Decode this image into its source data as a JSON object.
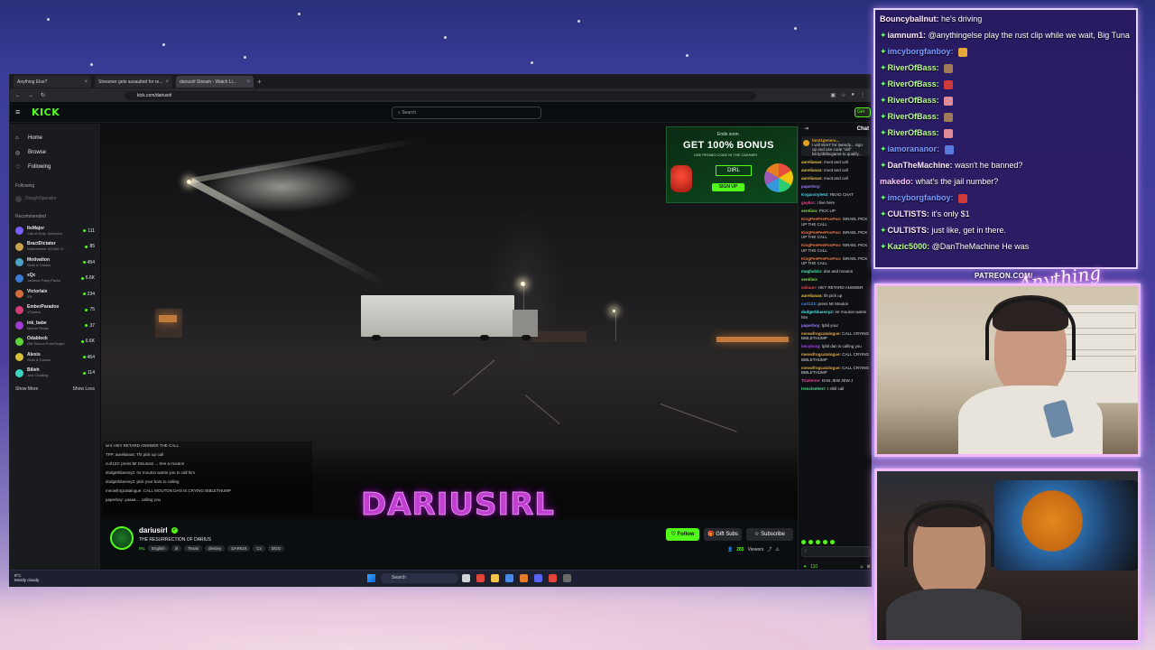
{
  "browser": {
    "tabs": [
      {
        "label": "Anything Else?",
        "active": false
      },
      {
        "label": "Streamer gets assaulted for re...",
        "active": false
      },
      {
        "label": "dariusirl Stream - Watch Li...",
        "active": true
      }
    ],
    "url": "kick.com/dariusirl"
  },
  "kick": {
    "logo": "KICK",
    "search_placeholder": "Search",
    "get_label": "Get",
    "nav": [
      {
        "label": "Home",
        "icon": "home-icon"
      },
      {
        "label": "Browse",
        "icon": "compass-icon"
      },
      {
        "label": "Following",
        "icon": "heart-icon"
      }
    ],
    "following_header": "Following",
    "followed_channel": "DoughOperator",
    "recommended_header": "Recommended",
    "recommended": [
      {
        "name": "ItsMajor",
        "category": "Call of Duty: Warzone",
        "viewers": "111",
        "color": "#7a5cff"
      },
      {
        "name": "BractDictator",
        "category": "Warhammer 40,000: D...",
        "viewers": "85",
        "color": "#c8a24a"
      },
      {
        "name": "Motivation",
        "category": "Slots & Casino",
        "viewers": "454",
        "color": "#4aa3c8"
      },
      {
        "name": "xQc",
        "category": "Jackbox Party Packs",
        "viewers": "6.6K",
        "color": "#3a7bd5"
      },
      {
        "name": "Victorlaix",
        "category": "IRL",
        "viewers": "234",
        "color": "#d56a3a"
      },
      {
        "name": "EmberParadox",
        "category": "VTubers",
        "viewers": "75",
        "color": "#d53a7b"
      },
      {
        "name": "ink_babe",
        "category": "Marvel Rivals",
        "viewers": "37",
        "color": "#a43ad5"
      },
      {
        "name": "Odablock",
        "category": "Old School RuneScape",
        "viewers": "6.6K",
        "color": "#5ad53a"
      },
      {
        "name": "Alexis",
        "category": "Slots & Casino",
        "viewers": "454",
        "color": "#d5c13a"
      },
      {
        "name": "Bilieh",
        "category": "Just Chatting",
        "viewers": "114",
        "color": "#3ad5c1"
      }
    ],
    "show_more": "Show More",
    "show_less": "Show Less"
  },
  "video": {
    "watermark": "DARIUSIRL",
    "overlay_chat": [
      "ivnl: HEY RETARD ANSWER THE CALL",
      "TFP: aurelianas: Tfs pick up call",
      "curl123: press Mr Moutons ... tree a mouton",
      "dodgerbluesny2: mr mouton wants you to call him",
      "dodgerbluesny2: pick your bars to calling",
      "meowfrogcatalogue: CALL MOUTON DAN IS CRYING BIBLETHUMP",
      "paperboy: yaaaa ... calling you"
    ],
    "ad": {
      "small": "Ends soon",
      "title": "GET 100% BONUS",
      "subtitle": "USE PROMO CODE IN THE CASHIER",
      "code": "DIRL",
      "button": "SIGN UP"
    }
  },
  "stream": {
    "channel": "dariusirl",
    "title": "THE RESURRECTION OF DARIUS",
    "category": "IRL",
    "tags": [
      "English",
      "irl",
      "Texas",
      "destiny",
      "DARIUS",
      "Cx",
      "DGG"
    ],
    "follow": "Follow",
    "gift_subs": "Gift Subs",
    "subscribe": "Subscribe",
    "viewers": "265",
    "viewers_label": "Viewers"
  },
  "site_chat": {
    "header": "Chat",
    "pinned_user": "bm21genera...",
    "pinned_text": "I will WAIT for tweedy... sign up and use code \"dirl\" bit.ly/dirlbcgame to qualify...",
    "messages": [
      {
        "user": "aurelianas:",
        "text": "moot and call",
        "color": "#e6c34a"
      },
      {
        "user": "aurelianas:",
        "text": "moot and call",
        "color": "#e6c34a"
      },
      {
        "user": "aurelianas:",
        "text": "moot and call",
        "color": "#e6c34a"
      },
      {
        "user": "paperboy:",
        "text": "",
        "color": "#9d7bff"
      },
      {
        "user": "Koganstyle62:",
        "text": "READ CHAT",
        "color": "#4ad0e6"
      },
      {
        "user": "gaybrc:",
        "text": "I live here",
        "color": "#e64a8a"
      },
      {
        "user": "sentiiso:",
        "text": "PICK UP",
        "color": "#8ae64a"
      },
      {
        "user": "KingPeePeePooPoo:",
        "text": "ISRAEL PICK UP THE CALL",
        "color": "#e67b4a"
      },
      {
        "user": "KingPeePeePooPoo:",
        "text": "ISRAEL PICK UP THE CALL",
        "color": "#e67b4a"
      },
      {
        "user": "KingPeePeePooPoo:",
        "text": "ISRAEL PICK UP THE CALL",
        "color": "#e67b4a"
      },
      {
        "user": "KingPeePeePooPoo:",
        "text": "ISRAEL PICK UP THE CALL",
        "color": "#e67b4a"
      },
      {
        "user": "maghalzio:",
        "text": "dan and mouton",
        "color": "#4ae6a8"
      },
      {
        "user": "sentiiso:",
        "text": "",
        "color": "#8ae64a"
      },
      {
        "user": "mikautr:",
        "text": "HEY RETARD ANSWER",
        "color": "#e64a4a"
      },
      {
        "user": "aurelianas:",
        "text": "tfs pick up",
        "color": "#e6c34a"
      },
      {
        "user": "curl123:",
        "text": "press Mr Mouton",
        "color": "#4a8ae6"
      },
      {
        "user": "dodgerbluesny2:",
        "text": "mr mouton wants him",
        "color": "#4ae6e6"
      },
      {
        "user": "paperboy:",
        "text": "lphil your",
        "color": "#9d7bff"
      },
      {
        "user": "meowfrogcatalogue:",
        "text": "CALL CRYING BIBLETHUMP",
        "color": "#e6a84a"
      },
      {
        "user": "imcyborg:",
        "text": "lphil dan is calling you",
        "color": "#a84ae6"
      },
      {
        "user": "meowfrogcatalogue:",
        "text": "CALL CRYING BIBLETHUMP",
        "color": "#e6a84a"
      },
      {
        "user": "meowfrogcatalogue:",
        "text": "CALL CRYING BIBLETHUMP",
        "color": "#e6a84a"
      },
      {
        "user": "Tristenne:",
        "text": "DAN JEW JEW J",
        "color": "#e64aa8"
      },
      {
        "user": "trenclsetterr:",
        "text": "I shill call",
        "color": "#4ae68a"
      }
    ],
    "input_placeholder": "/",
    "points": "110"
  },
  "taskbar": {
    "temp": "9°C",
    "weather": "Mostly cloudy",
    "search": "Search",
    "icons": [
      {
        "name": "task-view-icon",
        "color": "#cfd2d6"
      },
      {
        "name": "app-icon-red",
        "color": "#e0443a"
      },
      {
        "name": "folder-icon",
        "color": "#f2c14a"
      },
      {
        "name": "app-icon-multicolor",
        "color": "#4a8ae6"
      },
      {
        "name": "app-icon-orange",
        "color": "#e67b2a"
      },
      {
        "name": "discord-icon",
        "color": "#5865f2"
      },
      {
        "name": "chrome-icon",
        "color": "#e0443a"
      },
      {
        "name": "obs-icon",
        "color": "#6a6a6a"
      }
    ]
  },
  "overlay_chat": [
    {
      "user": "Bouncyballnut:",
      "text": "he's driving",
      "badge": false,
      "color": "#ffe9ff"
    },
    {
      "user": "iamnum1:",
      "text": "@anythingelse play the rust clip while we wait, Big Tuna",
      "badge": true,
      "color": "#ffe9ff"
    },
    {
      "user": "imcyborgfanboy:",
      "text": "",
      "badge": true,
      "color": "#7a9cff",
      "emote": "#e6a83a"
    },
    {
      "user": "RiverOfBass:",
      "text": "",
      "badge": true,
      "color": "#b8ff8a",
      "emote": "#a07a5a"
    },
    {
      "user": "RiverOfBass:",
      "text": "",
      "badge": true,
      "color": "#b8ff8a",
      "emote": "#d03a3a"
    },
    {
      "user": "RiverOfBass:",
      "text": "",
      "badge": true,
      "color": "#b8ff8a",
      "emote": "#e08a9a"
    },
    {
      "user": "RiverOfBass:",
      "text": "",
      "badge": true,
      "color": "#b8ff8a",
      "emote": "#a07a5a"
    },
    {
      "user": "RiverOfBass:",
      "text": "",
      "badge": true,
      "color": "#b8ff8a",
      "emote": "#e08a9a"
    },
    {
      "user": "iamorananor:",
      "text": "",
      "badge": true,
      "color": "#7a9cff",
      "emote": "#5a7ae0"
    },
    {
      "user": "DanTheMachine:",
      "text": "wasn't he banned?",
      "badge": true,
      "color": "#ffe9ff"
    },
    {
      "user": "makedo:",
      "text": "what's the jail number?",
      "badge": false,
      "color": "#ffc8ff"
    },
    {
      "user": "imcyborgfanboy:",
      "text": "",
      "badge": true,
      "color": "#7a9cff",
      "emote": "#d03a3a"
    },
    {
      "user": "CULTISTS:",
      "text": "it's only $1",
      "badge": true,
      "color": "#ffe9ff"
    },
    {
      "user": "CULTISTS:",
      "text": "just like, get in there.",
      "badge": true,
      "color": "#ffe9ff"
    },
    {
      "user": "Kazic5000:",
      "text": "@DanTheMachine He was",
      "badge": true,
      "color": "#b8ff8a"
    }
  ],
  "branding": {
    "patreon": "PATREON.COM/",
    "logo_text": "Anything Else?"
  }
}
